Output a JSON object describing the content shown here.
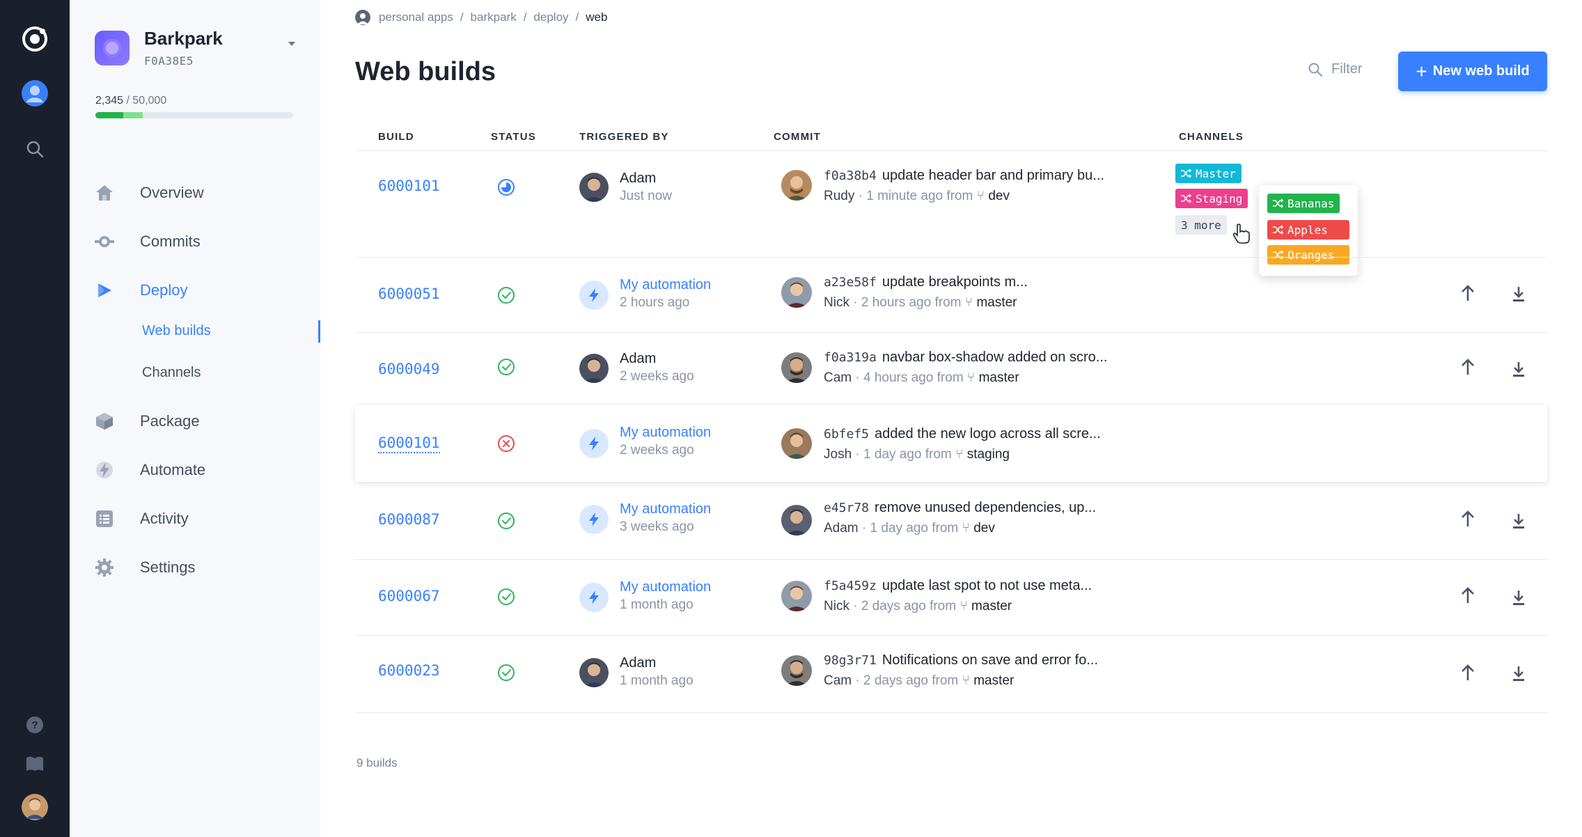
{
  "breadcrumb": [
    "personal apps",
    "barkpark",
    "deploy",
    "web"
  ],
  "app": {
    "name": "Barkpark",
    "id": "F0A38E5",
    "usage_current": "2,345",
    "usage_sep": " / ",
    "usage_max": "50,000",
    "usage_fraction": 0.047
  },
  "nav": {
    "overview": "Overview",
    "commits": "Commits",
    "deploy": "Deploy",
    "web_builds": "Web builds",
    "channels": "Channels",
    "package": "Package",
    "automate": "Automate",
    "activity": "Activity",
    "settings": "Settings"
  },
  "header": {
    "title": "Web builds",
    "filter": "Filter",
    "new_build": "New web build",
    "new_build_plus": "+"
  },
  "table": {
    "columns": [
      "BUILD",
      "STATUS",
      "TRIGGERED BY",
      "COMMIT",
      "CHANNELS"
    ],
    "rows": [
      {
        "build": "6000101",
        "status": "in-progress",
        "trigger_name": "Adam",
        "trigger_time": "Just now",
        "trigger_type": "user",
        "sha": "f0a38b4",
        "message": "update header bar and primary bu...",
        "author": "Rudy",
        "when": " · 1 minute ago from ",
        "branch": "dev"
      },
      {
        "build": "6000051",
        "status": "success",
        "trigger_name": "My automation",
        "trigger_time": "2 hours ago",
        "trigger_type": "automation",
        "sha": "a23e58f",
        "message": "update breakpoints m...",
        "author": "Nick",
        "when": " · 2 hours ago from ",
        "branch": "master"
      },
      {
        "build": "6000049",
        "status": "success",
        "trigger_name": "Adam",
        "trigger_time": "2 weeks ago",
        "trigger_type": "user",
        "sha": "f0a319a",
        "message": "navbar box-shadow added on scro...",
        "author": "Cam",
        "when": " · 4 hours ago from ",
        "branch": "master"
      },
      {
        "build": "6000101",
        "status": "failed",
        "trigger_name": "My automation",
        "trigger_time": "2 weeks ago",
        "trigger_type": "automation",
        "sha": "6bfef5",
        "message": "added the new logo across all scre...",
        "author": "Josh",
        "when": " · 1 day ago from ",
        "branch": "staging"
      },
      {
        "build": "6000087",
        "status": "success",
        "trigger_name": "My automation",
        "trigger_time": "3 weeks ago",
        "trigger_type": "automation",
        "sha": "e45r78",
        "message": "remove unused dependencies, up...",
        "author": "Adam",
        "when": " · 1 day ago from ",
        "branch": "dev"
      },
      {
        "build": "6000067",
        "status": "success",
        "trigger_name": "My automation",
        "trigger_time": "1 month ago",
        "trigger_type": "automation",
        "sha": "f5a459z",
        "message": "update last spot to not use meta...",
        "author": "Nick",
        "when": " · 2 days ago from ",
        "branch": "master"
      },
      {
        "build": "6000023",
        "status": "success",
        "trigger_name": "Adam",
        "trigger_time": "1 month ago",
        "trigger_type": "user",
        "sha": "98g3r71",
        "message": "Notifications on save and error fo...",
        "author": "Cam",
        "when": " · 2 days ago from ",
        "branch": "master"
      }
    ]
  },
  "channels": {
    "shown": [
      {
        "label": "Master",
        "color": "#12b8d6"
      },
      {
        "label": "Staging",
        "color": "#ec3f8c"
      }
    ],
    "more": "3 more",
    "popover": [
      {
        "label": "Bananas",
        "color": "#22b34b"
      },
      {
        "label": "Apples",
        "color": "#ef4a4a"
      },
      {
        "label": "Oranges",
        "color": "#f9a825"
      }
    ]
  },
  "footer": {
    "count": "9 builds"
  },
  "colors": {
    "accent": "#3880ff",
    "success": "#2fb45a",
    "error": "#ef4a4a",
    "rail": "#1a1f2c",
    "sidebar": "#f6f8fb"
  }
}
